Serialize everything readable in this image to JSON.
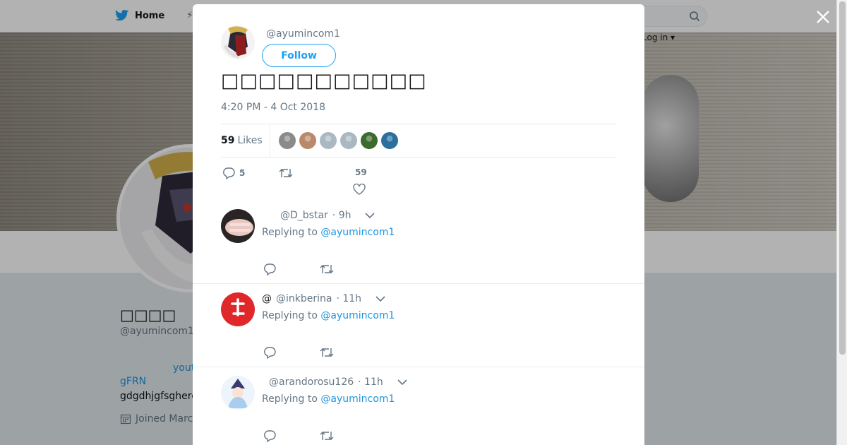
{
  "background": {
    "nav": {
      "home_label": "Home",
      "login_label": "Log in ▾"
    },
    "profile": {
      "name": "□□□□",
      "handle": "@ayumincom1",
      "link_you": "yout",
      "link_gfrn": "gFRN",
      "bio": "gdgdhjgfsghere",
      "joined": "Joined Marc"
    }
  },
  "modal": {
    "tweet": {
      "handle": "@ayumincom1",
      "follow_label": "Follow",
      "text": "□□□□□□□□□□□",
      "timestamp": "4:20 PM - 4 Oct 2018",
      "likes_count": "59",
      "likes_label": "Likes",
      "liker_colors": [
        "#8a8a8a",
        "#b98a6a",
        "#aab8c2",
        "#aab8c2",
        "#3c6b2e",
        "#2a6f9e"
      ],
      "reply_count": "5",
      "like_count_display": "59"
    },
    "replies": [
      {
        "at": "",
        "handle": "@D_bstar",
        "time": "· 9h",
        "replying_prefix": "Replying to",
        "replying_to": "@ayumincom1"
      },
      {
        "at": "@",
        "handle": "@inkberina",
        "time": "· 11h",
        "replying_prefix": "Replying to",
        "replying_to": "@ayumincom1"
      },
      {
        "at": "",
        "handle": "@arandorosu126",
        "time": "· 11h",
        "replying_prefix": "Replying to",
        "replying_to": "@ayumincom1"
      }
    ]
  },
  "colors": {
    "accent": "#1da1f2",
    "link": "#1b95e0",
    "muted": "#657786"
  }
}
